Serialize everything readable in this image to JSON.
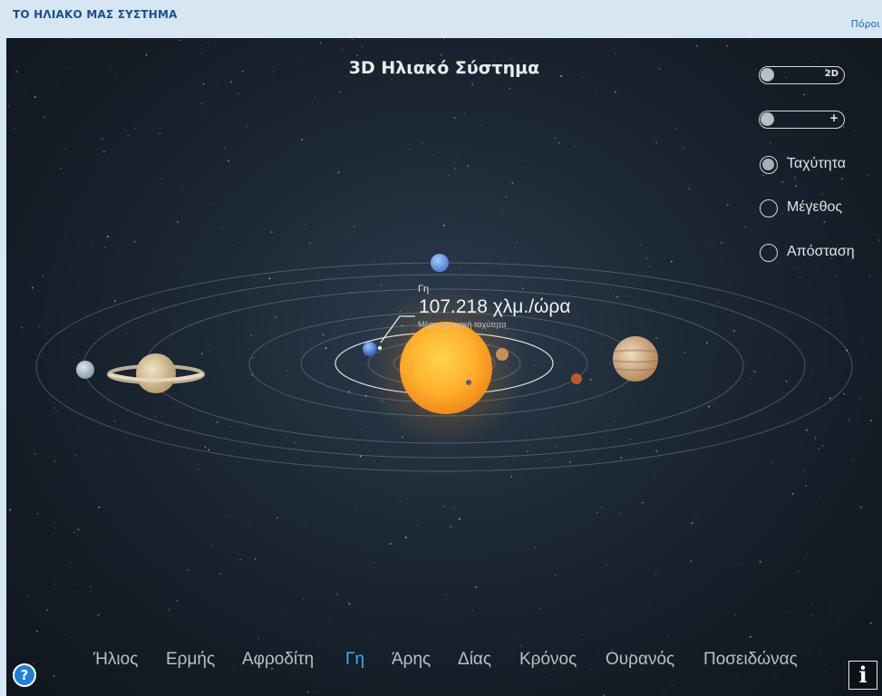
{
  "header": {
    "title": "ΤΟ ΗΛΙΑΚΟ ΜΑΣ ΣΥΣΤΗΜΑ",
    "resources_link": "Πόροι"
  },
  "sim": {
    "title": "3D Ηλιακό Σύστημα"
  },
  "controls": {
    "view_toggle_label": "2D",
    "zoom_toggle_label": "+",
    "radios": [
      {
        "label": "Ταχύτητα",
        "checked": true
      },
      {
        "label": "Μέγεθος",
        "checked": false
      },
      {
        "label": "Απόσταση",
        "checked": false
      }
    ]
  },
  "info": {
    "planet": "Γη",
    "value": "107.218 χλμ./ώρα",
    "caption": "Μέση τροχιακή ταχύτητα"
  },
  "nav": {
    "items": [
      "Ήλιος",
      "Ερμής",
      "Αφροδίτη",
      "Γη",
      "Άρης",
      "Δίας",
      "Κρόνος",
      "Ουρανός",
      "Ποσειδώνας"
    ],
    "active": "Γη"
  },
  "buttons": {
    "help": "?",
    "info": "i"
  },
  "colors": {
    "accent": "#39b3ea",
    "sun": "#ffb02e",
    "background": "#1e2a37",
    "header": "#d6e6f3"
  },
  "icons": {
    "help": "question-icon",
    "info": "info-icon"
  }
}
